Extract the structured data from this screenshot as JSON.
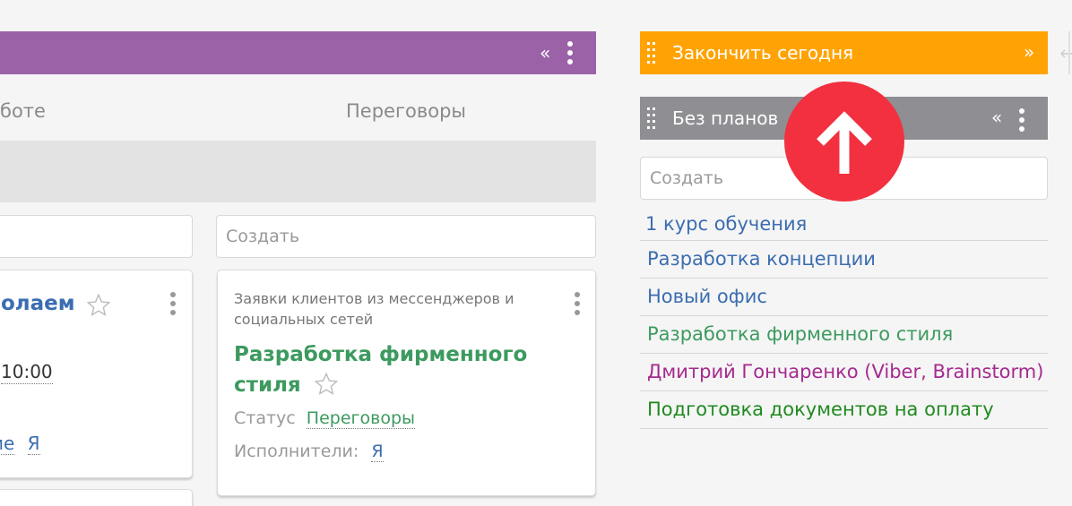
{
  "board": {
    "stage_header": {
      "collapse_label": "«"
    },
    "columns": [
      {
        "title": "боте",
        "create_placeholder": ""
      },
      {
        "title": "Переговоры",
        "create_placeholder": "Создать"
      }
    ],
    "left_card": {
      "title_fragment": "олаем",
      "date_fragment": "10:00",
      "link_fragment": "ие",
      "assignee": "Я"
    },
    "card": {
      "source": "Заявки клиентов из мессенджеров и социальных сетей",
      "title_line1": "Разработка фирменного",
      "title_line2": "стиля",
      "status_label": "Статус",
      "status_value": "Переговоры",
      "assignees_label": "Исполнители:",
      "assignees_value": "Я"
    }
  },
  "panel": {
    "finish_today": {
      "title": "Закончить сегодня",
      "expand_label": "»"
    },
    "no_plans": {
      "title": "Без планов",
      "collapse_label": "«",
      "create_placeholder": "Создать",
      "items": [
        {
          "label": "1 курс обучения",
          "color": "#3b6db0"
        },
        {
          "label": "Разработка концепции",
          "color": "#3b6db0"
        },
        {
          "label": "Новый офис",
          "color": "#3b6db0"
        },
        {
          "label": "Разработка фирменного стиля",
          "color": "#3c9a5f"
        },
        {
          "label": "Дмитрий Гончаренко (Viber, Brainstorm)",
          "color": "#a52a8f"
        },
        {
          "label": "Подготовка документов на оплату",
          "color": "#1f8a1f"
        }
      ]
    }
  },
  "colors": {
    "stage_purple": "#9b62a8",
    "finish_orange": "#ffa305",
    "no_plans_grey": "#8e8e93",
    "card_title_green": "#3c9a5f",
    "left_title_blue": "#3b6db0",
    "badge_red": "#f2303f"
  },
  "icons": {
    "star": "star-outline-icon",
    "arrow": "arrow-up-icon",
    "grip": "drag-handle-icon",
    "kebab": "kebab-menu-icon"
  }
}
